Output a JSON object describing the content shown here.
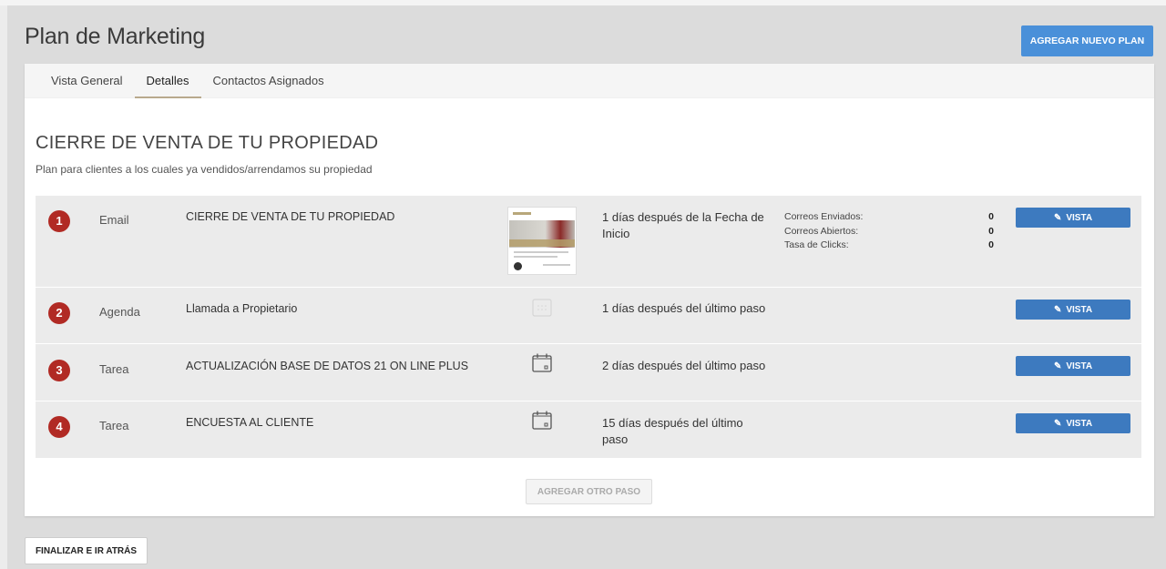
{
  "header": {
    "title": "Plan de Marketing",
    "add_plan_label": "AGREGAR NUEVO PLAN"
  },
  "tabs": [
    {
      "label": "Vista General",
      "active": false
    },
    {
      "label": "Detalles",
      "active": true
    },
    {
      "label": "Contactos Asignados",
      "active": false
    }
  ],
  "plan": {
    "name": "CIERRE DE VENTA DE TU PROPIEDAD",
    "description": "Plan para clientes a los cuales ya vendidos/arrendamos su propiedad"
  },
  "steps": [
    {
      "number": "1",
      "type": "Email",
      "name": "CIERRE DE VENTA DE TU PROPIEDAD",
      "icon": "email-thumbnail",
      "timing": "1 días después de la Fecha de Inicio",
      "stats": [
        {
          "label": "Correos Enviados:",
          "value": "0"
        },
        {
          "label": "Correos Abiertos:",
          "value": "0"
        },
        {
          "label": "Tasa de Clicks:",
          "value": "0"
        }
      ],
      "view_label": "VISTA"
    },
    {
      "number": "2",
      "type": "Agenda",
      "name": "Llamada a Propietario",
      "icon": "calendar-icon",
      "timing": "1 días después del último paso",
      "view_label": "VISTA"
    },
    {
      "number": "3",
      "type": "Tarea",
      "name": "ACTUALIZACIÓN BASE DE DATOS 21 ON LINE PLUS",
      "icon": "task-calendar-icon",
      "timing": "2 días después del último paso",
      "view_label": "VISTA"
    },
    {
      "number": "4",
      "type": "Tarea",
      "name": "ENCUESTA AL CLIENTE",
      "icon": "task-calendar-icon",
      "timing": "15 días después del último paso",
      "view_label": "VISTA"
    }
  ],
  "add_step_label": "AGREGAR OTRO PASO",
  "finalize_label": "FINALIZAR E IR ATRÁS",
  "colors": {
    "accent_blue": "#4a90d9",
    "vista_blue": "#3d7abf",
    "badge_red": "#b12a24",
    "tab_underline": "#b8a98d"
  }
}
